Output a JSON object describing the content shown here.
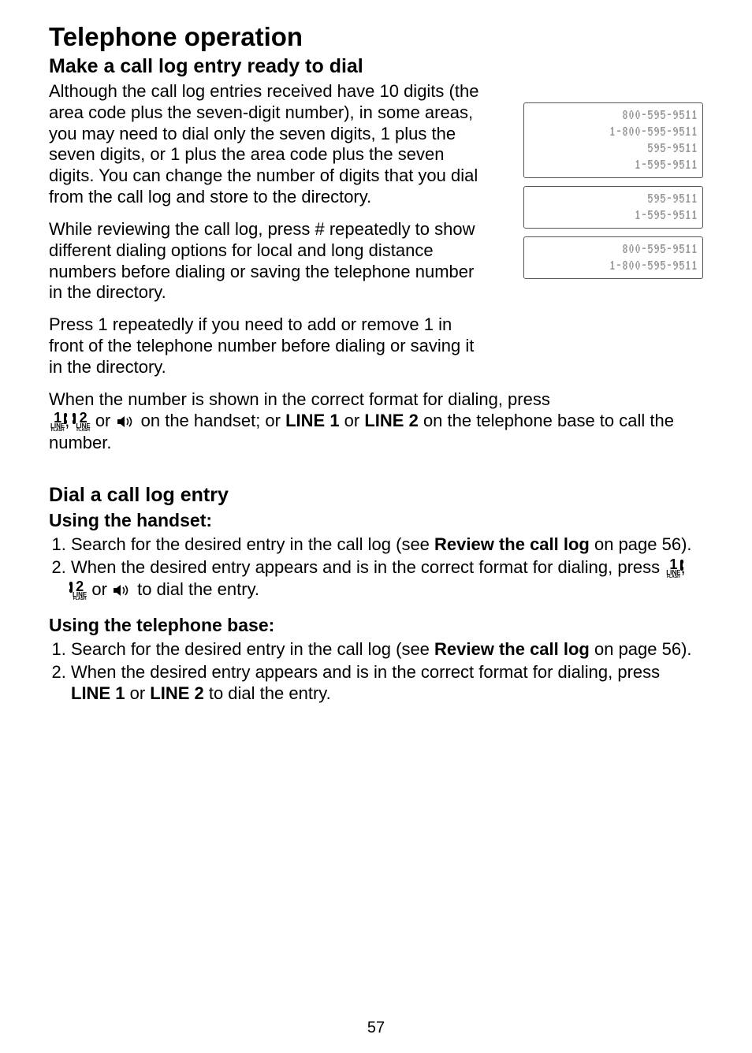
{
  "page_number": "57",
  "title": "Telephone operation",
  "section1": {
    "heading": "Make a call log entry ready to dial",
    "p1": "Although the call log entries received have 10 digits (the area code plus the seven-digit number), in some areas, you may need to dial only the seven digits, 1 plus the seven digits, or 1 plus the area code plus the seven digits. You can change the number of digits that you dial from the call log and store to the directory.",
    "p2": "While reviewing the call log, press # repeatedly to show different dialing options for local and long distance numbers before dialing or saving the telephone number in the directory.",
    "p3": "Press 1 repeatedly if you need to add or remove 1 in front of the telephone number before dialing or saving it in the directory.",
    "p4_pre": "When the number is shown in the correct format for dialing, press",
    "p4_mid": " on the handset; or ",
    "p4_b1": "LINE 1",
    "p4_or": " or ",
    "p4_b2": "LINE 2",
    "p4_post": " on the telephone base to call the number."
  },
  "section2": {
    "heading": "Dial a call log entry",
    "handset_heading": "Using the handset:",
    "handset_li1_pre": "Search for the desired entry in the call log (see ",
    "handset_li1_bold": "Review the call log",
    "handset_li1_post": " on page 56).",
    "handset_li2_pre": "When the desired entry appears and is in the correct format for dialing, press ",
    "handset_li2_post": "  to dial the entry.",
    "base_heading": "Using the telephone base:",
    "base_li1_pre": "Search for the desired entry in the call log (see ",
    "base_li1_bold": "Review the call log",
    "base_li1_post": " on page 56).",
    "base_li2_pre": "When the desired entry appears and is in the correct format for dialing, press ",
    "base_li2_b1": "LINE 1",
    "base_li2_or": " or ",
    "base_li2_b2": "LINE 2",
    "base_li2_post": " to dial the entry."
  },
  "lcd": {
    "box1": [
      "800-595-9511",
      "1-800-595-9511",
      "595-9511",
      "1-595-9511"
    ],
    "box2": [
      "595-9511",
      "1-595-9511"
    ],
    "box3": [
      "800-595-9511",
      "1-800-595-9511"
    ]
  },
  "icons": {
    "line1_num": "1",
    "line1_label": "LINE",
    "line1_sub": "FLASH",
    "line2_num": "2",
    "line2_label": "LINE",
    "line2_sub": "FLASH",
    "sep_comma": ", ",
    "sep_or": " or "
  }
}
